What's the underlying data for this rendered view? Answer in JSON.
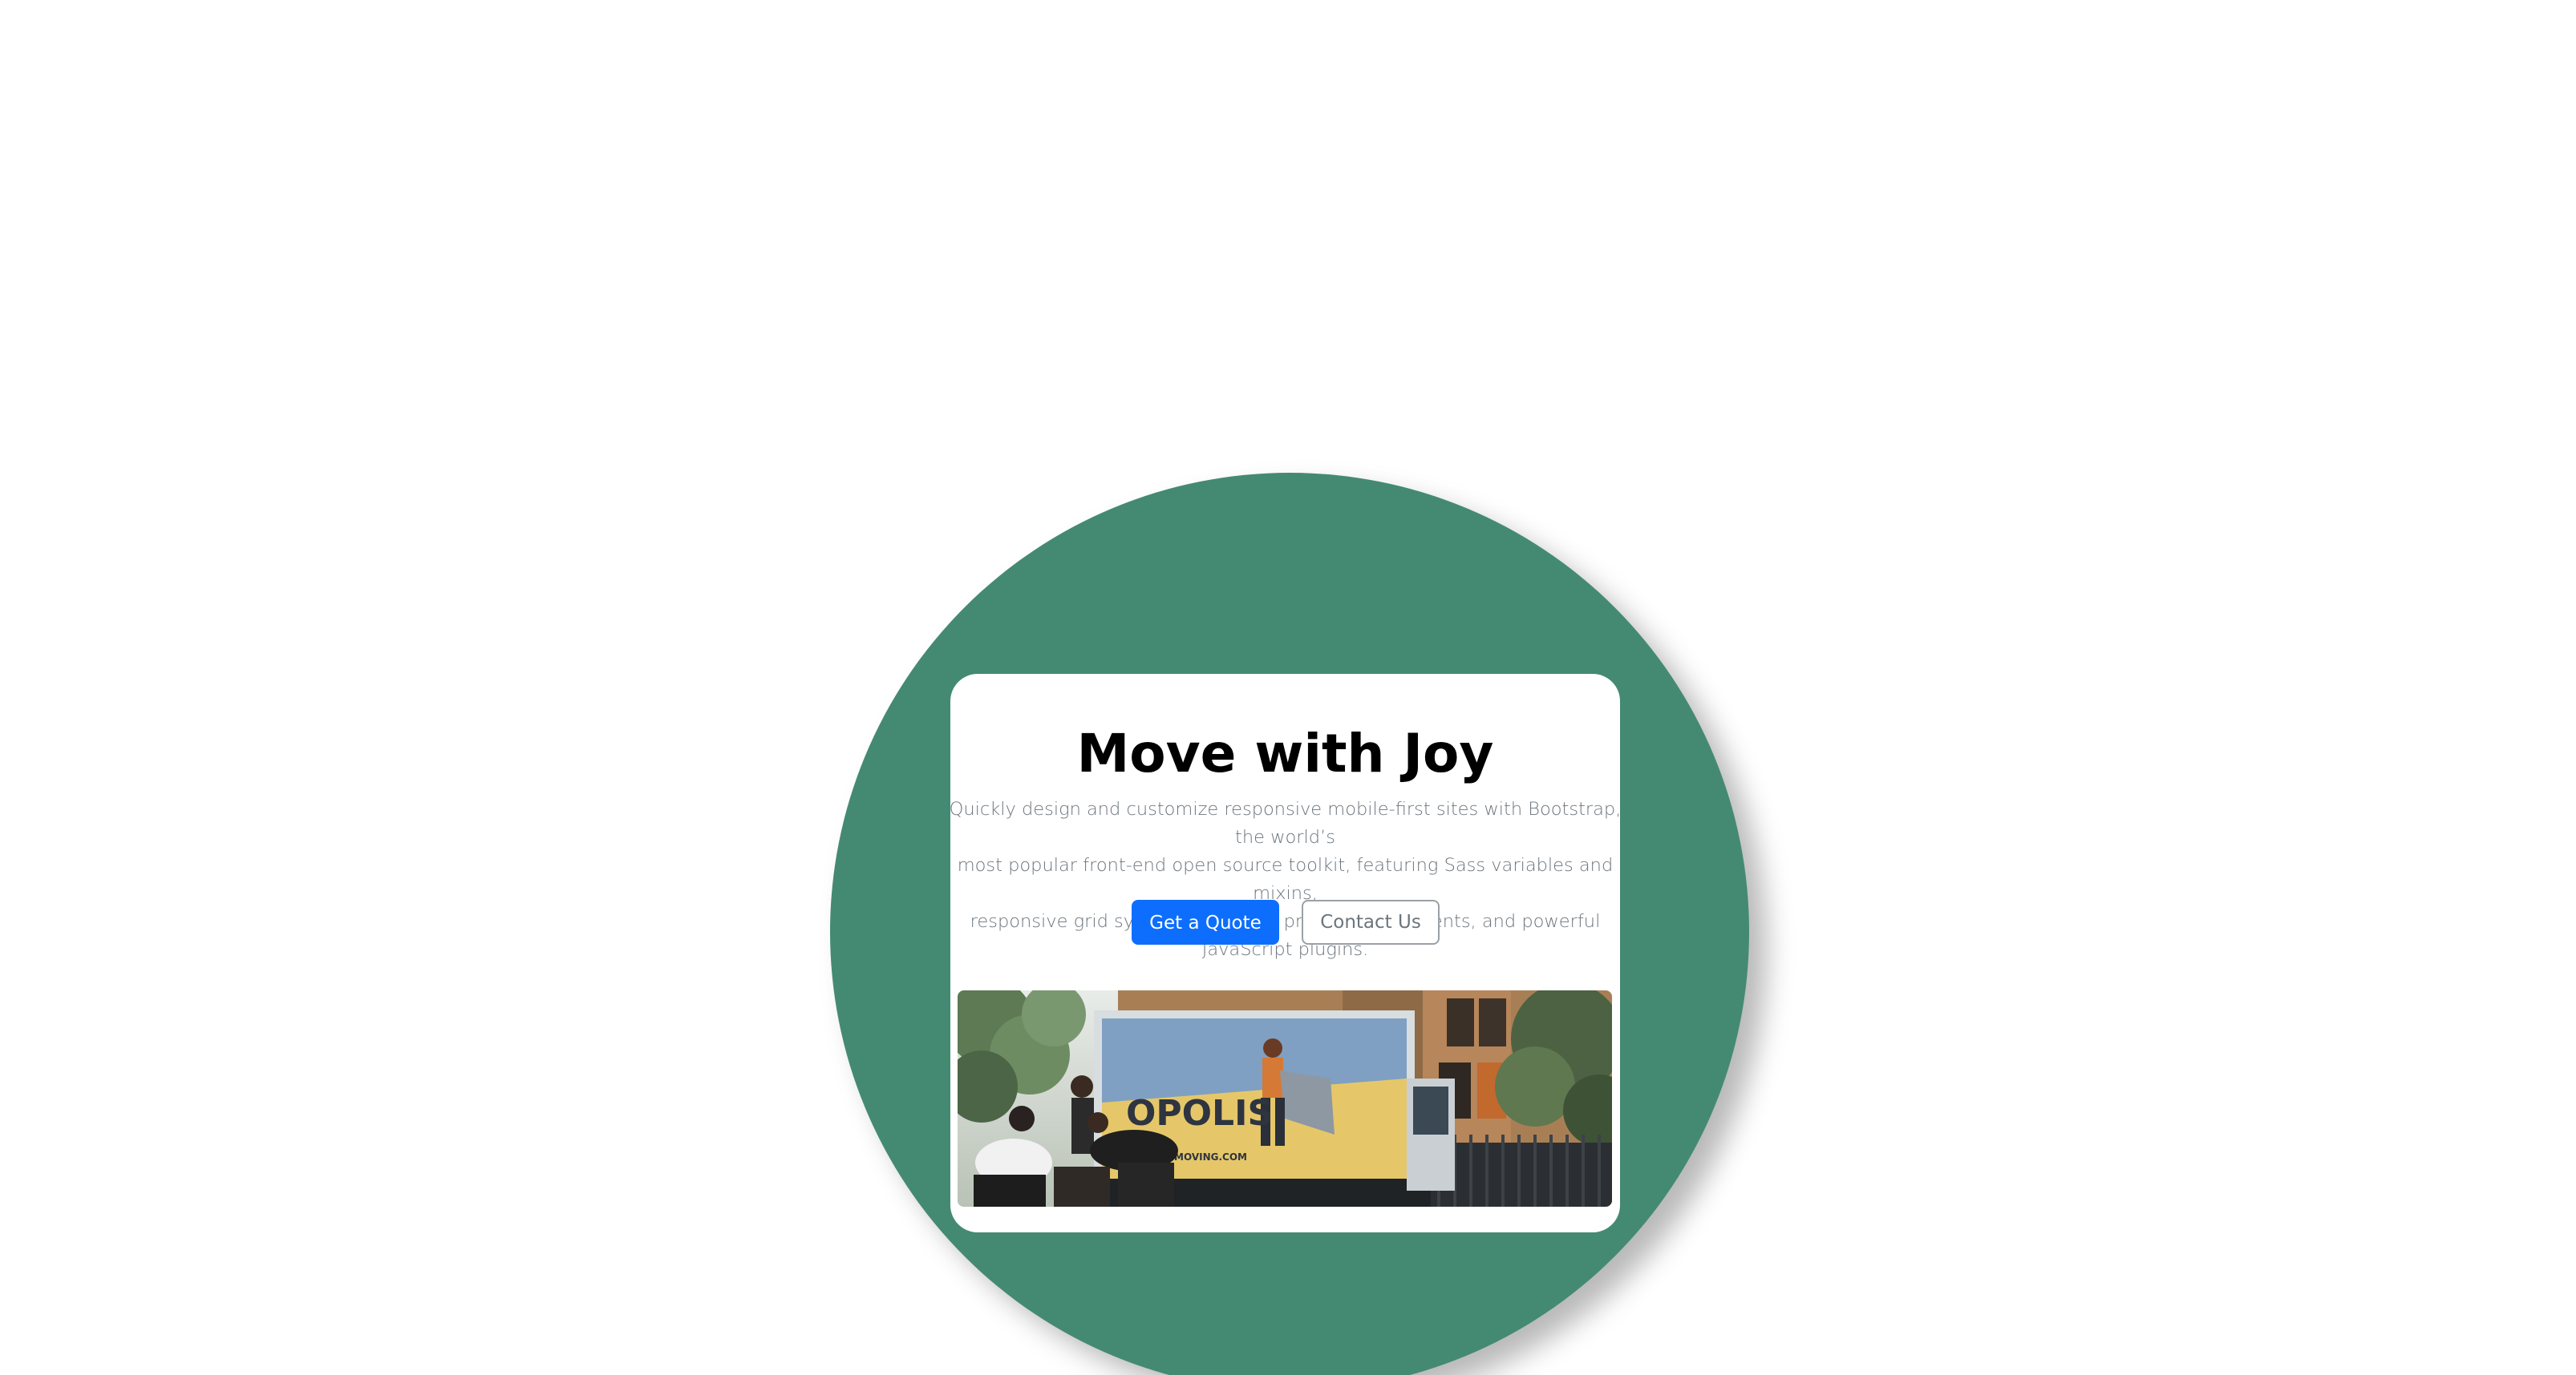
{
  "hero": {
    "title": "Move with Joy",
    "description": "Quickly design and customize responsive mobile-first sites with Bootstrap, the world’s\nmost popular front-end open source toolkit, featuring Sass variables and mixins,\nresponsive grid system, extensive prebuilt components, and powerful JavaScript plugins.",
    "primary_button": "Get a Quote",
    "secondary_button": "Contact Us"
  },
  "photo": {
    "truck_text": "OPOLIS",
    "truck_url_text": "MOVING.COM"
  },
  "colors": {
    "circle": "#448a73",
    "primary": "#0d6efd",
    "muted_text": "#6c757d",
    "card": "#ffffff"
  }
}
